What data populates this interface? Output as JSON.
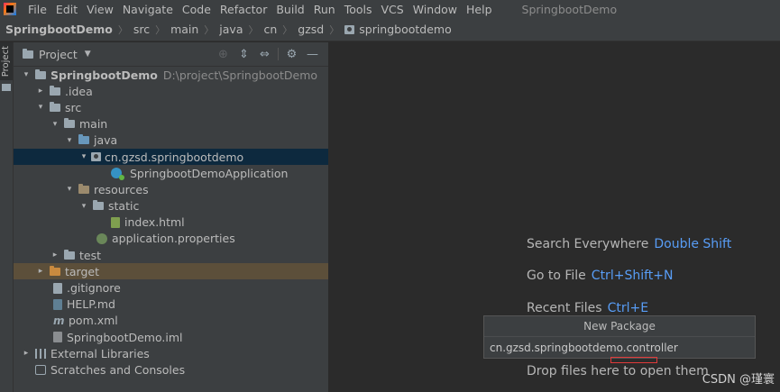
{
  "menubar": {
    "items": [
      "File",
      "Edit",
      "View",
      "Navigate",
      "Code",
      "Refactor",
      "Build",
      "Run",
      "Tools",
      "VCS",
      "Window",
      "Help"
    ],
    "project_title": "SpringbootDemo"
  },
  "breadcrumb": {
    "items": [
      "SpringbootDemo",
      "src",
      "main",
      "java",
      "cn",
      "gzsd",
      "springbootdemo"
    ]
  },
  "strip": {
    "project_tab": "Project"
  },
  "panel": {
    "title": "Project",
    "tree": [
      {
        "label": "SpringbootDemo",
        "path": "D:\\project\\SpringbootDemo"
      },
      {
        "label": ".idea"
      },
      {
        "label": "src"
      },
      {
        "label": "main"
      },
      {
        "label": "java"
      },
      {
        "label": "cn.gzsd.springbootdemo"
      },
      {
        "label": "SpringbootDemoApplication"
      },
      {
        "label": "resources"
      },
      {
        "label": "static"
      },
      {
        "label": "index.html"
      },
      {
        "label": "application.properties"
      },
      {
        "label": "test"
      },
      {
        "label": "target"
      },
      {
        "label": ".gitignore"
      },
      {
        "label": "HELP.md"
      },
      {
        "label": "pom.xml"
      },
      {
        "label": "SpringbootDemo.iml"
      },
      {
        "label": "External Libraries"
      },
      {
        "label": "Scratches and Consoles"
      }
    ]
  },
  "editor": {
    "hints": [
      {
        "text": "Search Everywhere",
        "key": "Double Shift"
      },
      {
        "text": "Go to File",
        "key": "Ctrl+Shift+N"
      },
      {
        "text": "Recent Files",
        "key": "Ctrl+E"
      },
      {
        "text": "Drop files here to open them",
        "key": ""
      }
    ]
  },
  "popup": {
    "title": "New Package",
    "value": "cn.gzsd.springbootdemo.controller"
  },
  "watermark": "CSDN @瑾寰",
  "colors": {
    "background": "#2b2b2b",
    "panel": "#3c3f41",
    "selected_row": "#0d293e",
    "excluded_row": "#5c4f3a",
    "hint_key": "#589df6",
    "highlight_box": "#e03a3a"
  }
}
